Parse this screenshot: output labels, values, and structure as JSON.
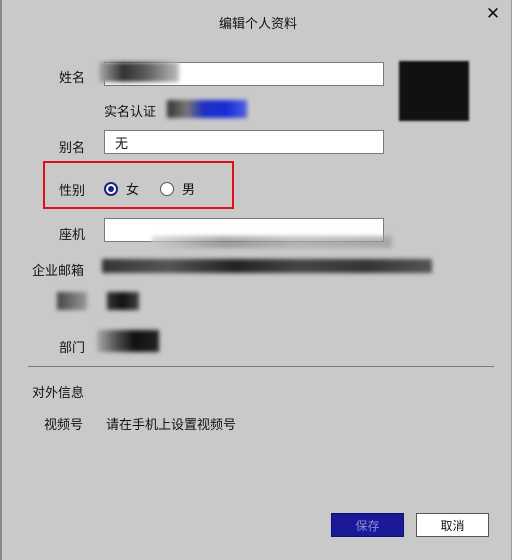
{
  "dialog": {
    "title": "编辑个人资料",
    "close_symbol": "✕"
  },
  "form": {
    "name_label": "姓名",
    "realname_label": "实名认证",
    "alias_label": "别名",
    "alias_value": "无",
    "gender_label": "性别",
    "gender_options": [
      "女",
      "男"
    ],
    "gender_selected": "女",
    "phone_label": "座机",
    "phone_value": "",
    "email_label": "企业邮箱",
    "dept_label": "部门"
  },
  "external": {
    "section_title": "对外信息",
    "video_label": "视频号",
    "video_value": "请在手机上设置视频号"
  },
  "footer": {
    "save_label": "保存",
    "cancel_label": "取消"
  },
  "colors": {
    "background": "#c9c9c9",
    "accent": "#1a237e",
    "highlight": "#e0101a",
    "save_button": "#1a1a99"
  },
  "icons": {
    "close": "close-icon",
    "radio_selected": "radio-selected-icon",
    "radio_unselected": "radio-unselected-icon"
  }
}
